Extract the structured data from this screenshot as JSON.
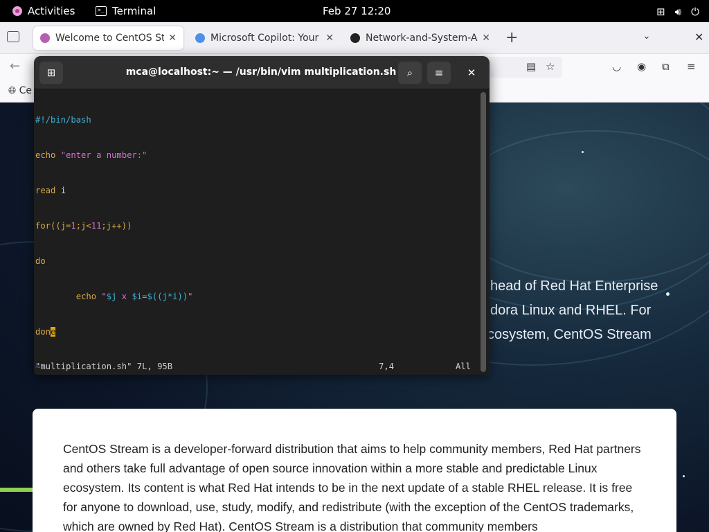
{
  "topbar": {
    "activities": "Activities",
    "app": "Terminal",
    "clock": "Feb 27  12:20"
  },
  "browser": {
    "tabs": [
      {
        "label": "Welcome to CentOS Strea",
        "color": "#b65fb0"
      },
      {
        "label": "Microsoft Copilot: Your AI",
        "color": "#4f8fe8"
      },
      {
        "label": "Network-and-System-Adm",
        "color": "#222222"
      }
    ],
    "bookmark": "Ce"
  },
  "page": {
    "hero_lines": [
      "head of Red Hat Enterprise",
      "dora Linux and RHEL. For",
      "cosystem, CentOS Stream"
    ],
    "card_text": "CentOS Stream is a developer-forward distribution that aims to help community members, Red Hat partners and others take full advantage of open source innovation within a more stable and predictable Linux ecosystem. Its content is what Red Hat intends to be in the next update of a stable RHEL release. It is free for anyone to download, use, study, modify, and redistribute (with the exception of the CentOS trademarks, which are owned by Red Hat). CentOS Stream is a distribution that community members"
  },
  "terminal": {
    "title": "mca@localhost:~ — /usr/bin/vim multiplication.sh",
    "code": {
      "l1": "#!/bin/bash",
      "l2_kw": "echo",
      "l2_str": "\"enter a number:\"",
      "l3_kw": "read",
      "l3_rest": " i",
      "l4_kw": "for",
      "l4_a": "((j=",
      "l4_n1": "1",
      "l4_b": ";j<",
      "l4_n2": "11",
      "l4_c": ";j++))",
      "l5": "do",
      "l6_indent": "        echo ",
      "l6_q1": "\"",
      "l6_v1": "$j",
      "l6_s1": " x ",
      "l6_v2": "$i",
      "l6_s2": "=",
      "l6_v3": "$((j*i))",
      "l6_q2": "\"",
      "l7_a": "don",
      "l7_cursor": "e"
    },
    "tilde": "~",
    "status_file": "\"multiplication.sh\" 7L, 95B",
    "status_pos": "7,4",
    "status_all": "All"
  }
}
